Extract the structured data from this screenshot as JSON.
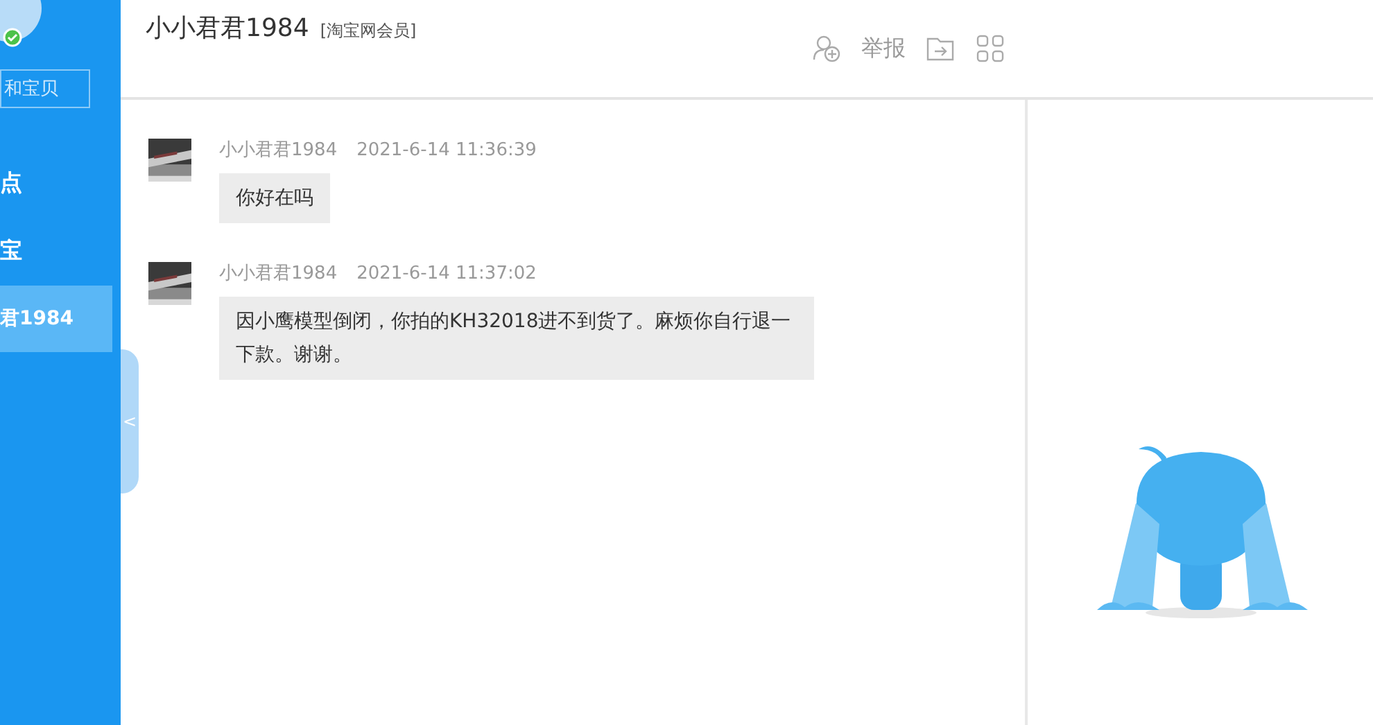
{
  "sidebar": {
    "search": {
      "placeholder": "和宝贝"
    },
    "items": [
      {
        "label": "点",
        "selected": false
      },
      {
        "label": "宝",
        "selected": false
      },
      {
        "label": "君1984",
        "selected": true
      }
    ]
  },
  "header": {
    "title": "小小君君1984",
    "badge": "[淘宝网会员]",
    "actions": [
      {
        "kind": "add-user"
      },
      {
        "kind": "text",
        "label": "举报"
      },
      {
        "kind": "folder"
      },
      {
        "kind": "grid"
      }
    ]
  },
  "messages": [
    {
      "sender": "小小君君1984",
      "time": "2021-6-14 11:36:39",
      "text": "你好在吗"
    },
    {
      "sender": "小小君君1984",
      "time": "2021-6-14 11:37:02",
      "text": "因小鹰模型倒闭，你拍的KH32018进不到货了。麻烦你自行退一下款。谢谢。"
    }
  ],
  "collapse_toggle": "<"
}
